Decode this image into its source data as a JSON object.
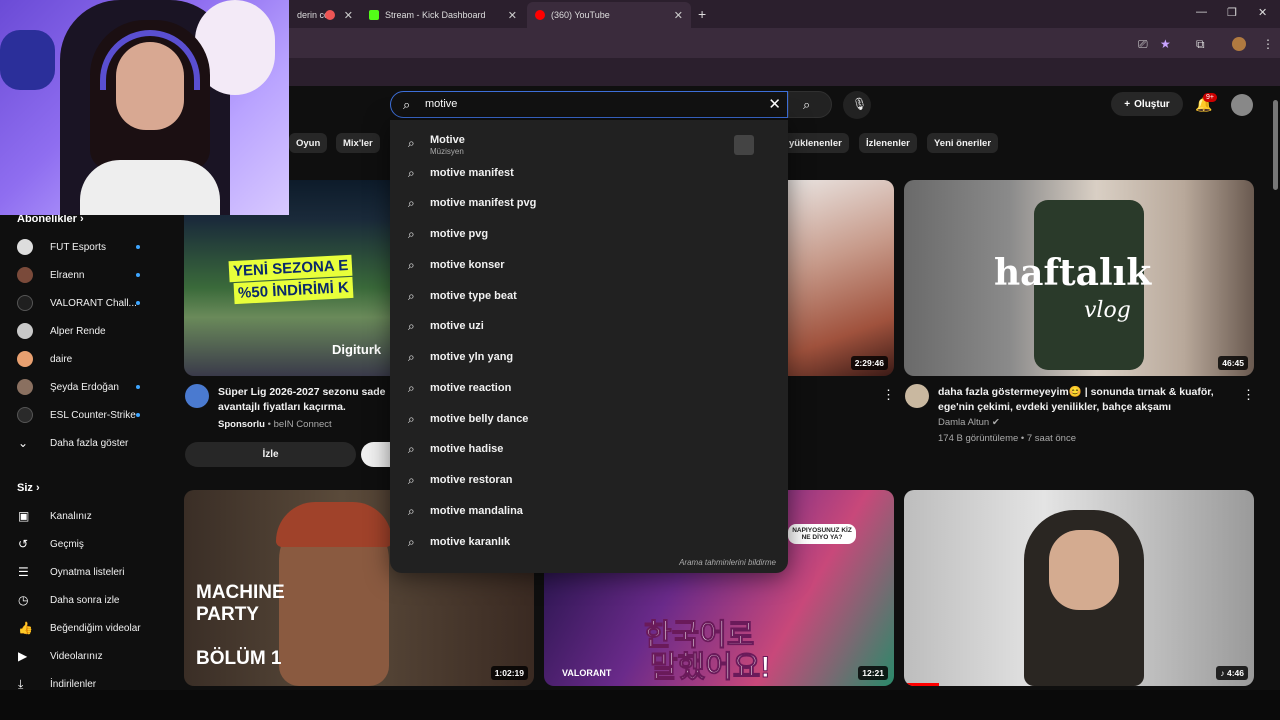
{
  "browser": {
    "tabs": [
      {
        "label": "derin co",
        "active": false
      },
      {
        "label": "Stream - Kick Dashboard",
        "active": false
      },
      {
        "label": "(360) YouTube",
        "active": true
      }
    ]
  },
  "youtube": {
    "search": {
      "value": "motive"
    },
    "create_label": "Oluştur",
    "notifications_badge": "9+",
    "chips": [
      "Oyun",
      "Mix'ler",
      "yüklenenler",
      "İzlenenler",
      "Yeni öneriler"
    ]
  },
  "suggestions": {
    "top": {
      "title": "Motive",
      "subtitle": "Müzisyen"
    },
    "items": [
      "motive manifest",
      "motive manifest pvg",
      "motive pvg",
      "motive konser",
      "motive type beat",
      "motive uzi",
      "motive yln yang",
      "motive reaction",
      "motive belly dance",
      "motive hadise",
      "motive restoran",
      "motive mandalina",
      "motive karanlık"
    ],
    "report_label": "Arama tahminlerini bildirme"
  },
  "sidebar": {
    "subscriptions_label": "Abonelikler",
    "channels": [
      {
        "name": "FUT Esports",
        "dot": true,
        "color": "#dddddd"
      },
      {
        "name": "Elraenn",
        "dot": true,
        "color": "#7a4a3a"
      },
      {
        "name": "VALORANT Chall...",
        "dot": true,
        "color": "#1f1f1f"
      },
      {
        "name": "Alper Rende",
        "dot": false,
        "color": "#c9c9c9"
      },
      {
        "name": "daire",
        "dot": false,
        "color": "#e8a070"
      },
      {
        "name": "Şeyda Erdoğan",
        "dot": true,
        "color": "#8a7060"
      },
      {
        "name": "ESL Counter-Strike",
        "dot": true,
        "color": "#2a2a2a"
      }
    ],
    "show_more_label": "Daha fazla göster",
    "you_label": "Siz",
    "you_items": [
      {
        "label": "Kanalınız",
        "icon": "channel-icon"
      },
      {
        "label": "Geçmiş",
        "icon": "history-icon"
      },
      {
        "label": "Oynatma listeleri",
        "icon": "playlists-icon"
      },
      {
        "label": "Daha sonra izle",
        "icon": "watch-later-icon"
      },
      {
        "label": "Beğendiğim videolar",
        "icon": "like-icon"
      },
      {
        "label": "Videolarınız",
        "icon": "your-videos-icon"
      },
      {
        "label": "İndirilenler",
        "icon": "downloads-icon"
      }
    ]
  },
  "videos": {
    "ad": {
      "banner_line1": "YENİ SEZONA E",
      "banner_line2": "%50 İNDİRİMİ K",
      "brand": "Digiturk",
      "title_line1": "Süper Lig 2026-2027 sezonu sade",
      "title_line2": "avantajlı fiyatları kaçırma.",
      "sponsored_label": "Sponsorlu",
      "sponsor": "beIN Connect",
      "watch_label": "İzle"
    },
    "v2": {
      "duration": "2:29:46"
    },
    "v3": {
      "thumb_text1": "haftalık",
      "thumb_text2": "vlog",
      "duration": "46:45",
      "title_line1": "daha fazla göstermeyeyim😊 | sonunda tırnak & kuaför,",
      "title_line2": "ege'nin çekimi, evdeki yenilikler, bahçe akşamı",
      "channel": "Damla Altun",
      "meta": "174 B görüntüleme • 7 saat önce"
    },
    "v4": {
      "text1": "MACHINE",
      "text2": "PARTY",
      "text3": "BÖLÜM 1",
      "duration": "1:02:19"
    },
    "v5": {
      "text1": "한국어로",
      "text2": "말했어요!",
      "bubble": "NAPIYOSUNUZ KİZ NE DİYO YA?",
      "brand": "VALORANT",
      "duration": "12:21"
    },
    "v6": {
      "duration": "4:46"
    }
  }
}
